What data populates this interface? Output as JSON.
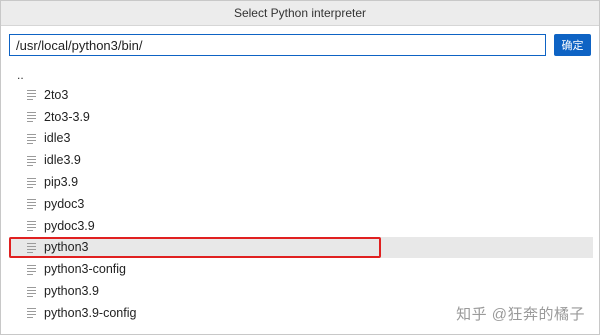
{
  "dialog": {
    "title": "Select Python interpreter"
  },
  "path": {
    "value": "/usr/local/python3/bin/",
    "ok_label": "确定"
  },
  "list": {
    "parent_label": "..",
    "items": [
      {
        "name": "2to3",
        "icon": "file-icon"
      },
      {
        "name": "2to3-3.9",
        "icon": "file-icon"
      },
      {
        "name": "idle3",
        "icon": "file-icon"
      },
      {
        "name": "idle3.9",
        "icon": "file-icon"
      },
      {
        "name": "pip3.9",
        "icon": "file-icon"
      },
      {
        "name": "pydoc3",
        "icon": "file-icon"
      },
      {
        "name": "pydoc3.9",
        "icon": "file-icon"
      },
      {
        "name": "python3",
        "icon": "file-icon",
        "selected": true
      },
      {
        "name": "python3-config",
        "icon": "file-icon"
      },
      {
        "name": "python3.9",
        "icon": "file-icon"
      },
      {
        "name": "python3.9-config",
        "icon": "file-icon"
      }
    ]
  },
  "watermark": "知乎 @狂奔的橘子",
  "colors": {
    "accent": "#0e63c4",
    "highlight_border": "#e02020",
    "selected_bg": "#e8e8e8"
  }
}
